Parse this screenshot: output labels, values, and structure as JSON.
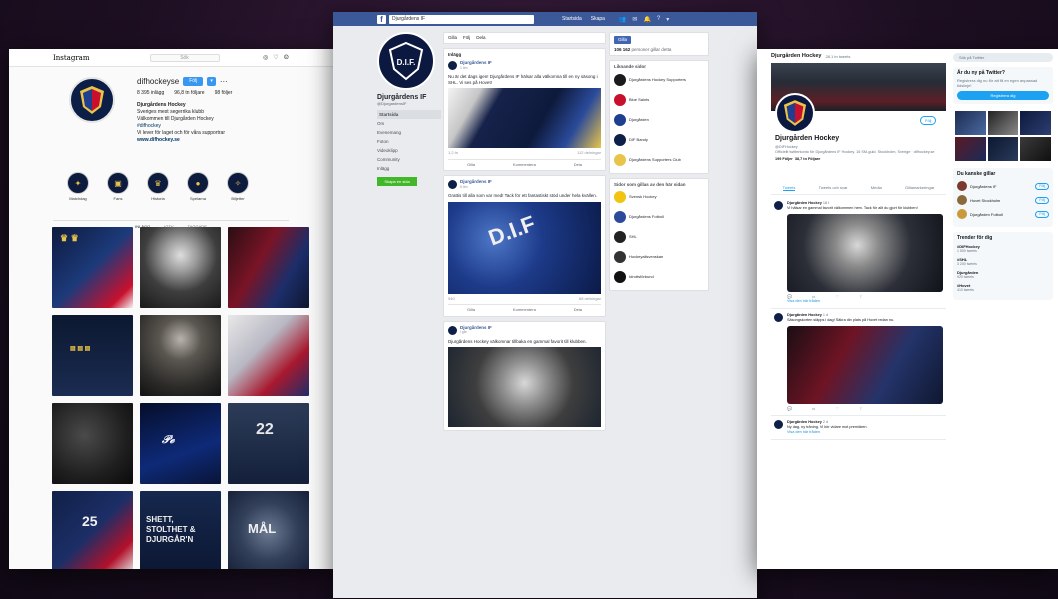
{
  "colors": {
    "ig_blue": "#3897f0",
    "fb_blue": "#3b5998",
    "tw_blue": "#1da1f2",
    "club_navy": "#0b1840",
    "club_gold": "#e8c44a"
  },
  "instagram": {
    "logo": "Instagram",
    "search_placeholder": "Sök",
    "icons": [
      "compass-icon",
      "heart-icon",
      "user-icon"
    ],
    "username": "difhockeyse",
    "follow_label": "Följ",
    "stats": [
      "8 395 inlägg",
      "96,8 tn följare",
      "98 följer"
    ],
    "bio": [
      "Djurgårdens Hockey",
      "Sveriges mest segerrika klubb",
      "Välkommen till Djurgården Hockey",
      "#difhockey",
      "Vi lever för laget och för våra supportrar",
      "www.difhockey.se"
    ],
    "highlights": [
      "Matchdag",
      "Fans",
      "Historia",
      "Spelarna",
      "Biljetter"
    ],
    "tabs": [
      "INLÄGG",
      "IGTV",
      "TAGGADE"
    ],
    "tiles": [
      "",
      "",
      "",
      "",
      "",
      "",
      "",
      "",
      "22",
      "25",
      "SHETT, STOLTHET & DJURGÅR'N",
      "MÅL"
    ]
  },
  "facebook": {
    "search_value": "Djurgårdens IF",
    "nav": [
      "Startsida",
      "Skapa"
    ],
    "page_name": "Djurgårdens IF",
    "page_handle": "@DjurgardensIF",
    "left_nav": [
      "Startsida",
      "Om",
      "Evenemang",
      "Foton",
      "Videoklipp",
      "Community",
      "Inlägg"
    ],
    "create_label": "Skapa en sida",
    "tab_buttons": [
      "Gilla",
      "Följ",
      "Dela"
    ],
    "posts_header": "Inlägg",
    "posts": [
      {
        "author": "Djurgårdens IF",
        "meta": "1 tim",
        "text": "Nu är det dags igen! Djurgårdens IF hälsar alla välkomna till en ny säsong i SHL. Vi ses på Hovet!",
        "likes": "1,2 tn",
        "shares": "112 delningar"
      },
      {
        "author": "Djurgårdens IF",
        "meta": "5 tim",
        "text": "Grattis till alla som var med! Tack för ett fantastiskt stöd under hela kvällen.",
        "likes": "940",
        "shares": "68 delningar"
      },
      {
        "author": "Djurgårdens IF",
        "meta": "i går",
        "text": "Djurgårdens Hockey välkomnar tillbaka en gammal favorit till klubben.",
        "likes": "2,4 tn",
        "shares": "210 delningar"
      }
    ],
    "actions": [
      "Gilla",
      "Kommentera",
      "Dela"
    ],
    "like_page_button": "Gilla",
    "follows_count": "106 162",
    "follows_label": "personer gillar detta",
    "related_header": "Liknande sidor",
    "related": [
      "Djurgårdens Hockey Supporters",
      "Blue Saints",
      "Djurgården",
      "DIF Bandy",
      "Djurgårdens Supporters Club"
    ],
    "liked_header": "Sidor som gillas av den här sidan",
    "liked": [
      "Svensk Hockey",
      "Djurgårdens Fotboll",
      "SHL",
      "Hockeyallsvenskan",
      "Idrottsförbund"
    ]
  },
  "twitter": {
    "header_name": "Djurgården Hockey",
    "header_count": "28,1 tn tweets",
    "name": "Djurgården Hockey",
    "handle": "@DIFHockey",
    "follow_label": "Följ",
    "description": "Officiellt twitterkonto för Djurgårdens IF Hockey. 16 SM-guld. Stockholm, Sverige · difhockey.se",
    "following": "199 Följer",
    "followers": "38,7 tn Följare",
    "tabs": [
      "Tweets",
      "Tweets och svar",
      "Media",
      "Gillamarkeringar"
    ],
    "tweets": [
      {
        "name": "Djurgården Hockey",
        "time": "18 t",
        "text": "Vi hälsar en gammal favorit välkommen hem. Tack för allt du gjort för klubben!",
        "link": "Visa den här tråden"
      },
      {
        "name": "Djurgården Hockey",
        "time": "1 d",
        "text": "Säsongskorten släpps i dag! Säkra din plats på Hovet redan nu.",
        "link": "Visa den här tråden"
      },
      {
        "name": "Djurgården Hockey",
        "time": "2 d",
        "text": "Ny dag, ny träning. Vi kör vidare mot premiären.",
        "link": "Visa den här tråden"
      }
    ],
    "search_placeholder": "Sök på Twitter",
    "signup_title": "Är du ny på Twitter?",
    "signup_text": "Registrera dig nu för att få en egen anpassad tidslinje!",
    "signup_button": "Registrera dig",
    "who_header": "Du kanske gillar",
    "who": [
      "Djurgårdens IF",
      "Hovet Stockholm",
      "Djurgården Fotboll"
    ],
    "who_button": "Följ",
    "trends_header": "Trender för dig",
    "trends": [
      {
        "tag": "#DIFHockey",
        "count": "1 500 tweets"
      },
      {
        "tag": "#SHL",
        "count": "3 200 tweets"
      },
      {
        "tag": "Djurgården",
        "count": "920 tweets"
      },
      {
        "tag": "#Hovet",
        "count": "410 tweets"
      }
    ]
  }
}
